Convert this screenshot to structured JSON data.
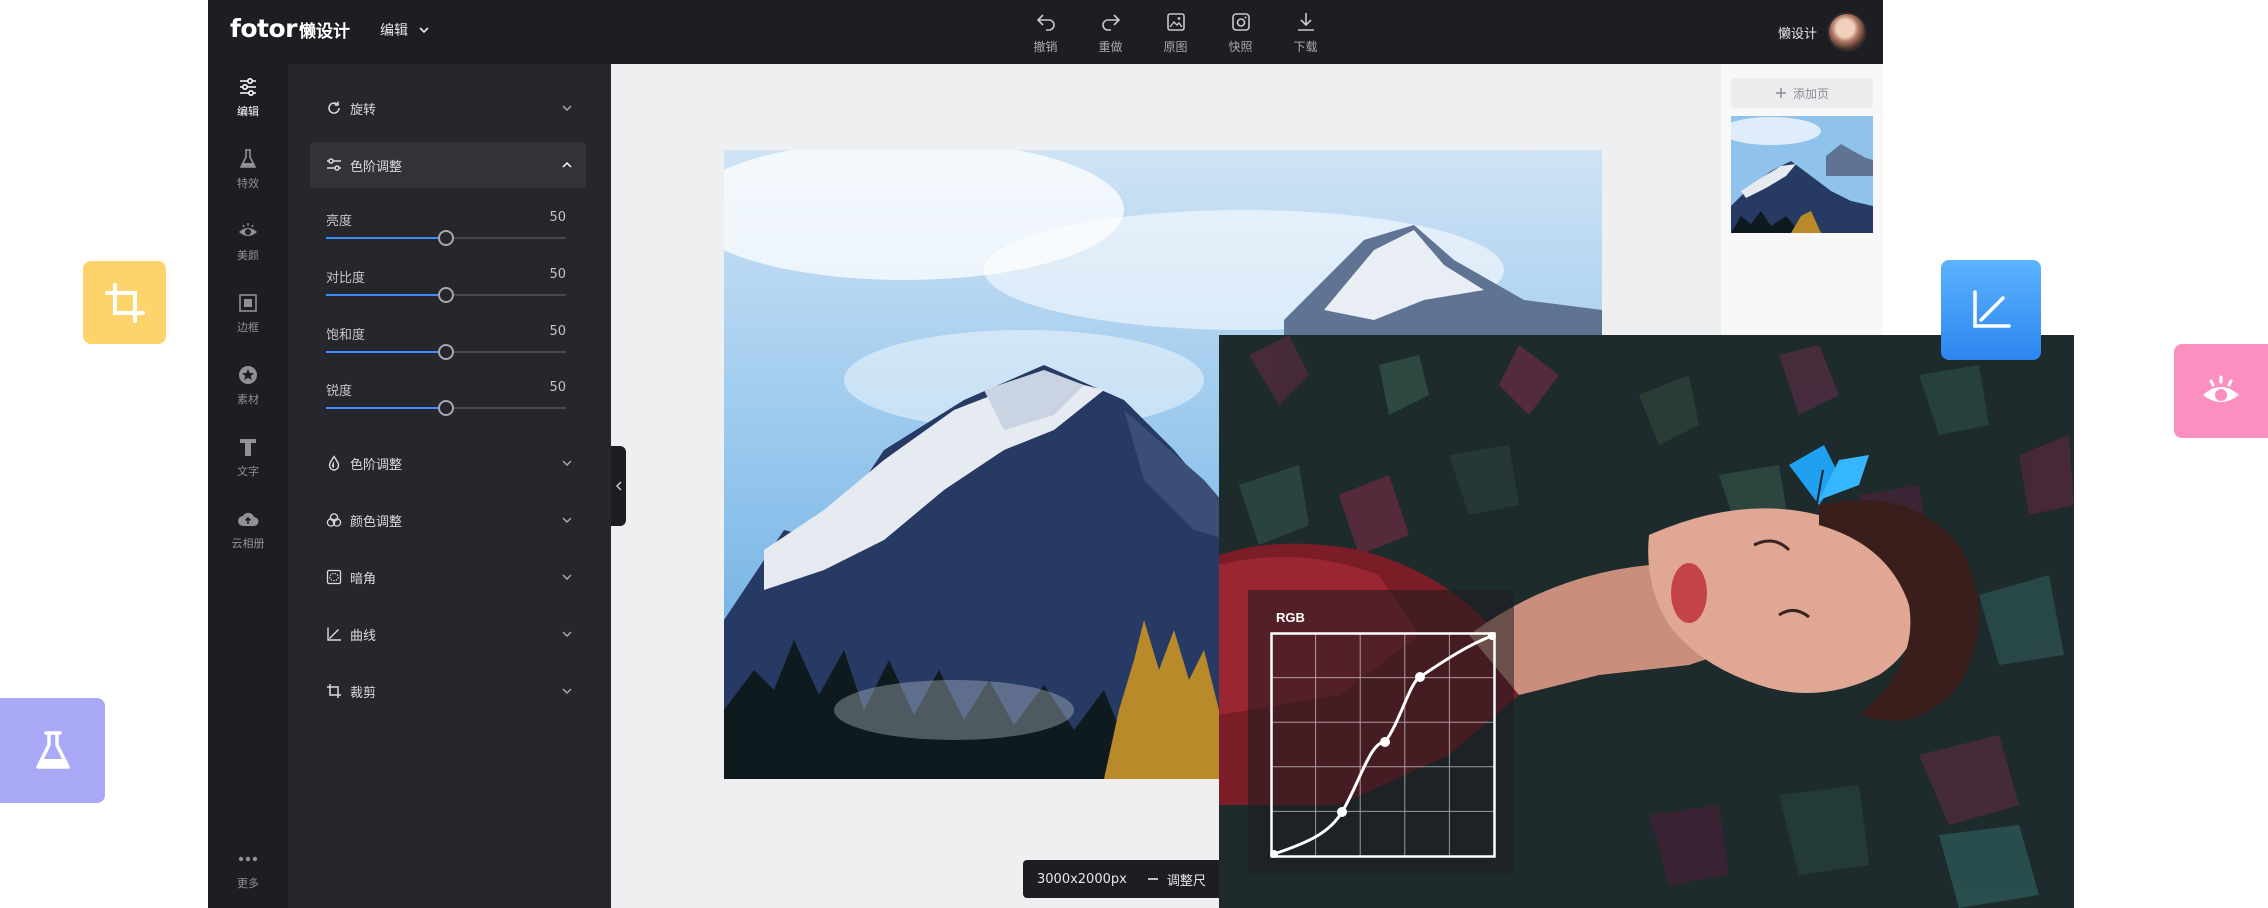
{
  "topbar": {
    "logo_main": "fotor",
    "logo_sub": "懒设计",
    "edit_menu": "编辑",
    "tools": [
      {
        "label": "撤销",
        "icon": "undo-icon"
      },
      {
        "label": "重做",
        "icon": "redo-icon"
      },
      {
        "label": "原图",
        "icon": "original-image-icon"
      },
      {
        "label": "快照",
        "icon": "snapshot-icon"
      },
      {
        "label": "下载",
        "icon": "download-icon"
      }
    ],
    "username": "懒设计"
  },
  "sidebar": {
    "items": [
      {
        "label": "编辑",
        "icon": "edit-sliders-icon"
      },
      {
        "label": "特效",
        "icon": "flask-icon"
      },
      {
        "label": "美颜",
        "icon": "eye-icon"
      },
      {
        "label": "边框",
        "icon": "frame-icon"
      },
      {
        "label": "素材",
        "icon": "sticker-icon"
      },
      {
        "label": "文字",
        "icon": "text-icon"
      },
      {
        "label": "云相册",
        "icon": "cloud-upload-icon"
      }
    ],
    "more_label": "更多"
  },
  "panel": {
    "rotate_label": "旋转",
    "levels_open_label": "色阶调整",
    "sliders": [
      {
        "label": "亮度",
        "value": "50",
        "fraction": 0.5
      },
      {
        "label": "对比度",
        "value": "50",
        "fraction": 0.5
      },
      {
        "label": "饱和度",
        "value": "50",
        "fraction": 0.5
      },
      {
        "label": "锐度",
        "value": "50",
        "fraction": 0.5
      }
    ],
    "sections": [
      {
        "label": "色阶调整",
        "icon": "droplet-icon"
      },
      {
        "label": "颜色调整",
        "icon": "color-circles-icon"
      },
      {
        "label": "暗角",
        "icon": "vignette-icon"
      },
      {
        "label": "曲线",
        "icon": "curve-icon"
      },
      {
        "label": "裁剪",
        "icon": "crop-icon"
      }
    ]
  },
  "right_panel": {
    "add_page_label": "添加页"
  },
  "status": {
    "dimensions": "3000x2000px",
    "resize_label": "调整尺"
  },
  "curve_overlay": {
    "channel": "RGB"
  },
  "colors": {
    "accent": "#3d8bff",
    "dark_bg": "#1d1e22",
    "panel_bg": "#26272c",
    "crop_tile": "#fdd36b",
    "curve_tile": "#3f9bf7",
    "eye_tile": "#fb8fbf",
    "flask_tile": "#a9a9f8"
  }
}
